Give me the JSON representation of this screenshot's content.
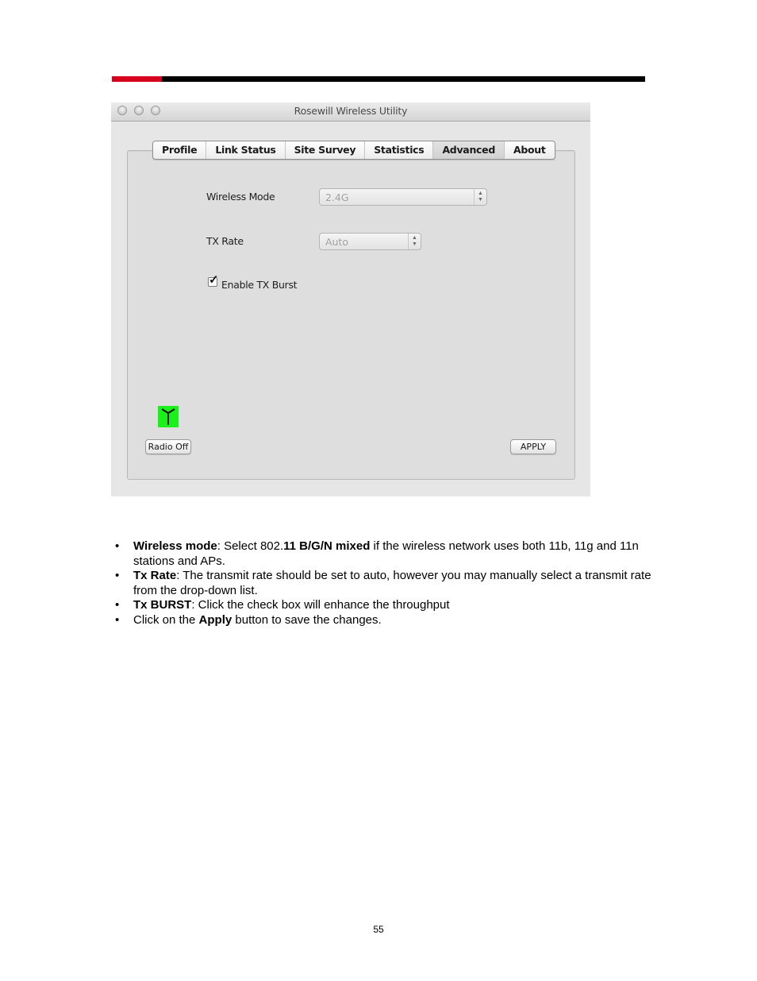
{
  "header": {
    "accent_color": "#d7001d",
    "bar_color": "#000000"
  },
  "window": {
    "title": "Rosewill Wireless Utility",
    "tabs": [
      {
        "label": "Profile",
        "active": false
      },
      {
        "label": "Link Status",
        "active": false
      },
      {
        "label": "Site Survey",
        "active": false
      },
      {
        "label": "Statistics",
        "active": false
      },
      {
        "label": "Advanced",
        "active": true
      },
      {
        "label": "About",
        "active": false
      }
    ],
    "wireless_mode": {
      "label": "Wireless Mode",
      "value": "2.4G"
    },
    "tx_rate": {
      "label": "TX Rate",
      "value": "Auto"
    },
    "tx_burst": {
      "label": "Enable TX Burst",
      "checked": true
    },
    "antenna_icon": {
      "name": "antenna-icon",
      "color": "#19f219"
    },
    "radio_off_label": "Radio Off",
    "apply_label": "APPLY"
  },
  "bullets": [
    {
      "bold": "Wireless mode",
      "pre": ": Select 802.",
      "bold2": "11 B/G/N mixed",
      "rest": " if the wireless network uses both 11b, 11g and 11n stations and APs."
    },
    {
      "bold": "Tx Rate",
      "rest": ": The transmit rate should be set to auto, however you may manually select a transmit rate from the drop-down list."
    },
    {
      "bold": "Tx BURST",
      "rest": ": Click the check box will enhance the throughput"
    },
    {
      "pre": "Click on the ",
      "bold": "Apply",
      "rest": " button to save the changes."
    }
  ],
  "page_number": "55"
}
